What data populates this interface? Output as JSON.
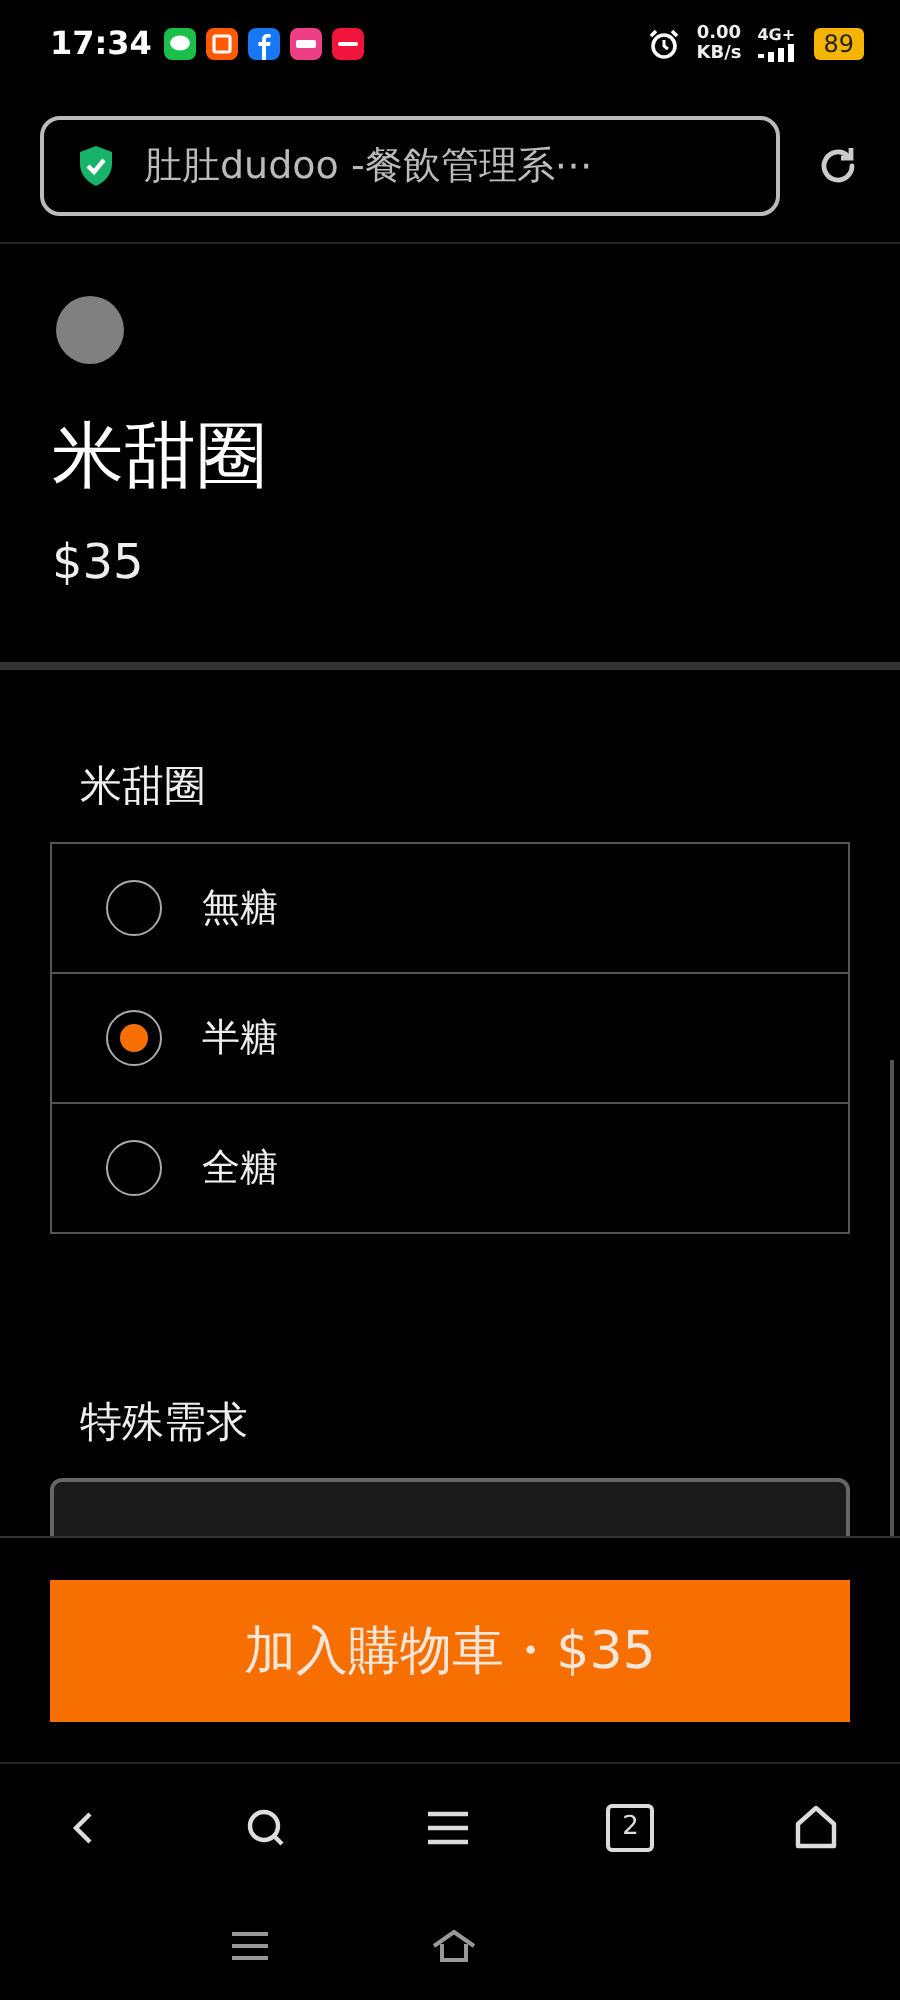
{
  "status_bar": {
    "time": "17:34",
    "speed": "0.00",
    "speed_unit": "KB/s",
    "network": "4G+",
    "battery": "89"
  },
  "address_bar": {
    "title": "肚肚dudoo -餐飲管理系⋯"
  },
  "product": {
    "name": "米甜圈",
    "price": "$35"
  },
  "option_group": {
    "title": "米甜圈",
    "options": [
      {
        "label": "無糖",
        "selected": false
      },
      {
        "label": "半糖",
        "selected": true
      },
      {
        "label": "全糖",
        "selected": false
      }
    ]
  },
  "special_request": {
    "title": "特殊需求"
  },
  "add_to_cart": {
    "label": "加入購物車・$35"
  },
  "browser_nav": {
    "tab_count": "2"
  }
}
